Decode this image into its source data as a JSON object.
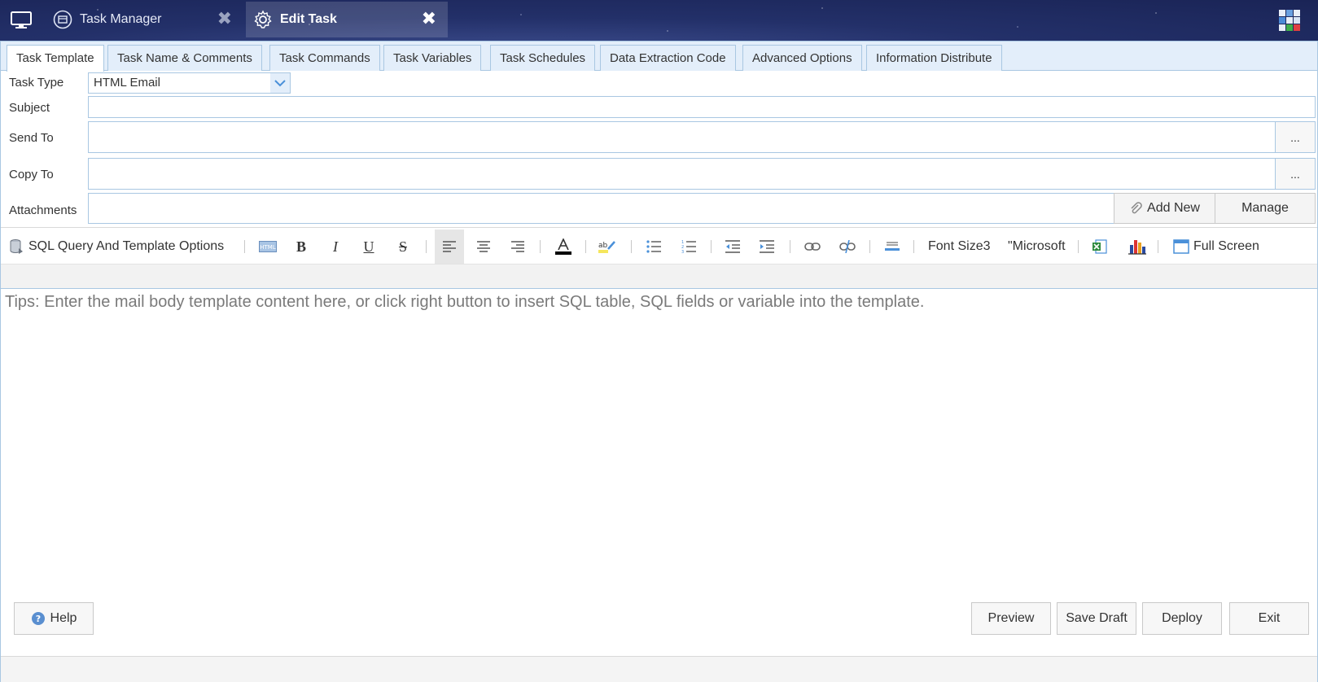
{
  "window_tabs": [
    {
      "label": "Task Manager",
      "icon": "task-manager-icon",
      "active": false
    },
    {
      "label": "Edit Task",
      "icon": "gear-icon",
      "active": true
    }
  ],
  "close_glyph": "✖",
  "tabs": [
    {
      "label": "Task Template",
      "active": true
    },
    {
      "label": "Task Name & Comments",
      "active": false
    },
    {
      "label": "Task Commands",
      "active": false
    },
    {
      "label": "Task Variables",
      "active": false
    },
    {
      "label": "Task Schedules",
      "active": false
    },
    {
      "label": "Data Extraction Code",
      "active": false
    },
    {
      "label": "Advanced Options",
      "active": false
    },
    {
      "label": "Information Distribute",
      "active": false
    }
  ],
  "form": {
    "task_type": {
      "label": "Task Type",
      "value": "HTML Email"
    },
    "subject": {
      "label": "Subject",
      "value": ""
    },
    "send_to": {
      "label": "Send To",
      "value": "",
      "browse": "..."
    },
    "copy_to": {
      "label": "Copy To",
      "value": "",
      "browse": "..."
    },
    "attachments": {
      "label": "Attachments",
      "value": "",
      "add_new": "Add New",
      "manage": "Manage"
    }
  },
  "toolbar": {
    "sql_options": "SQL Query And Template Options",
    "font_size": "Font Size3",
    "font_name": "\"Microsoft",
    "full_screen": "Full Screen",
    "buttons": [
      "html-icon",
      "bold-icon",
      "italic-icon",
      "underline-icon",
      "strikethrough-icon",
      "align-left-icon",
      "align-center-icon",
      "align-right-icon",
      "font-color-icon",
      "highlight-icon",
      "bullet-list-icon",
      "numbered-list-icon",
      "outdent-icon",
      "indent-icon",
      "link-icon",
      "unlink-icon",
      "horizontal-rule-icon",
      "excel-icon",
      "chart-icon"
    ],
    "accent_color": "#4a90d9"
  },
  "editor": {
    "tips": "Tips: Enter the mail body template content here, or click right button to insert SQL table, SQL fields or variable into the template."
  },
  "footer": {
    "help": "Help",
    "preview": "Preview",
    "save_draft": "Save Draft",
    "deploy": "Deploy",
    "exit": "Exit"
  },
  "colors": {
    "border": "#a9c7e2",
    "tab_bg": "#e3eefa",
    "titlebar": "#233069"
  }
}
